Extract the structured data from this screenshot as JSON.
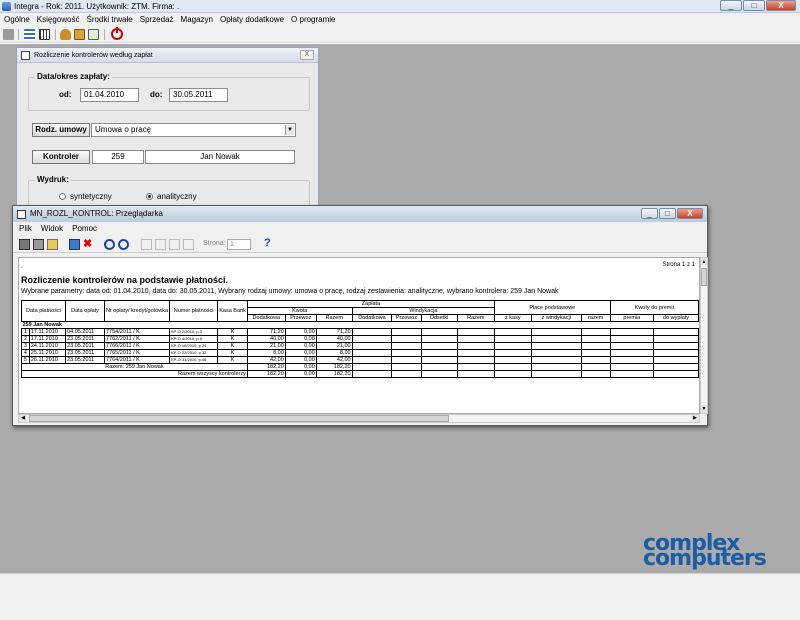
{
  "app": {
    "title": "Integra - Rok: 2011. Użytkownik: ZTM. Firma: .",
    "minimize": "_",
    "maximize": "□",
    "close": "X"
  },
  "menu": [
    "Ogólne",
    "Księgowość",
    "Środki trwałe",
    "Sprzedaż",
    "Magazyn",
    "Opłaty dodatkowe",
    "O programie"
  ],
  "toolbar_icons": [
    "tool-icon",
    "list-icon",
    "grid-icon",
    "users-icon",
    "lock-icon",
    "calendar-check-icon",
    "power-icon"
  ],
  "dialog": {
    "title": "Rozliczenie kontrolerów według zapłat",
    "close": "X",
    "period_group": "Data/okres zapłaty:",
    "from_label": "od:",
    "from_value": "01.04.2010",
    "to_label": "do:",
    "to_value": "30.05.2011",
    "contract_button": "Rodz. umowy",
    "contract_value": "Umowa o pracę",
    "controller_button": "Kontroler",
    "controller_id": "259",
    "controller_name": "Jan Nowak",
    "print_group": "Wydruk:",
    "opt_synthetic": "syntetyczny",
    "opt_analytic": "analityczny",
    "selected": "analityczny"
  },
  "viewer": {
    "title": "MN_ROZL_KONTROL: Przeglądarka",
    "menu": [
      "Plik",
      "Widok",
      "Pomoc"
    ],
    "page_label": "Strona:",
    "page_value": "1",
    "help": "?",
    "minimize": "_",
    "maximize": "□",
    "close": "X"
  },
  "report": {
    "page_info": "Strona 1 z 1",
    "dot": ".",
    "title": "Rozliczenie kontrolerów na podstawie płatności.",
    "params": "Wybrane parametry: data od: 01.04.2010, data do: 30.05.2011, Wybrany rodzaj umowy:  umowa o pracę, rodzaj zestawienia:  analityczne, wybrano kontrolera: 259 Jan Nowak",
    "headers": {
      "data_platnosci": "Data płatności",
      "data_oplaty": "Data opłaty",
      "nr_oplaty": "Nr opłaty/ kredyt/gotówka",
      "numer_platnosci": "Numer płatności",
      "kasa_bank": "Kasa Bank",
      "zaplata": "Zapłata",
      "kwota": "Kwota",
      "windykacja": "Windykacja",
      "dodatkowa": "Dodatkowa",
      "przewoz": "Przewoz",
      "razem": "Razem",
      "odsetki": "Odsetki",
      "place": "Płace podstawowe",
      "z_kasy": "z kasy",
      "z_windykacji": "z windykacji",
      "razem2": "razem",
      "kwoty_premii": "Kwoty do premii",
      "premia": "premia",
      "do_wyplaty": "do wypłaty"
    },
    "section": "259 Jan Nowak",
    "rows": [
      {
        "lp": "1",
        "data_pl": "17.11.2010",
        "data_op": "04.05.2011",
        "nr": "7754/2011 / K",
        "numer": "KP-O 2/2010, p.3",
        "kb": "K",
        "dod": "71,20",
        "prz": "0,00",
        "raz": "71,20"
      },
      {
        "lp": "2",
        "data_pl": "17.11.2010",
        "data_op": "23.05.2011",
        "nr": "7762/2011 / K",
        "numer": "KP-O 4/2010, p.5",
        "kb": "K",
        "dod": "40,00",
        "prz": "0,00",
        "raz": "40,00"
      },
      {
        "lp": "3",
        "data_pl": "24.11.2010",
        "data_op": "23.05.2011",
        "nr": "7766/2011 / K",
        "numer": "KP-O 16/2010, p.24",
        "kb": "K",
        "dod": "21,00",
        "prz": "0,00",
        "raz": "21,00"
      },
      {
        "lp": "4",
        "data_pl": "25.11.2010",
        "data_op": "23.05.2011",
        "nr": "7765/2011 / K",
        "numer": "KP-O 22/2010, p.32",
        "kb": "K",
        "dod": "8,00",
        "prz": "0,00",
        "raz": "8,00"
      },
      {
        "lp": "5",
        "data_pl": "26.11.2010",
        "data_op": "23.05.2011",
        "nr": "7764/2011 / K",
        "numer": "KP-O 31/2010, p.46",
        "kb": "K",
        "dod": "42,00",
        "prz": "0,00",
        "raz": "42,00"
      }
    ],
    "subtotal_label": "Razem: 259 Jan Nowak",
    "subtotal": {
      "dod": "182,20",
      "prz": "0,00",
      "raz": "182,20"
    },
    "total_label": "Razem wszyscy kontrolerzy",
    "total": {
      "dod": "182,20",
      "prz": "0,00",
      "raz": "182,20"
    }
  },
  "logo": {
    "line1": "complex",
    "line2": "computers"
  }
}
